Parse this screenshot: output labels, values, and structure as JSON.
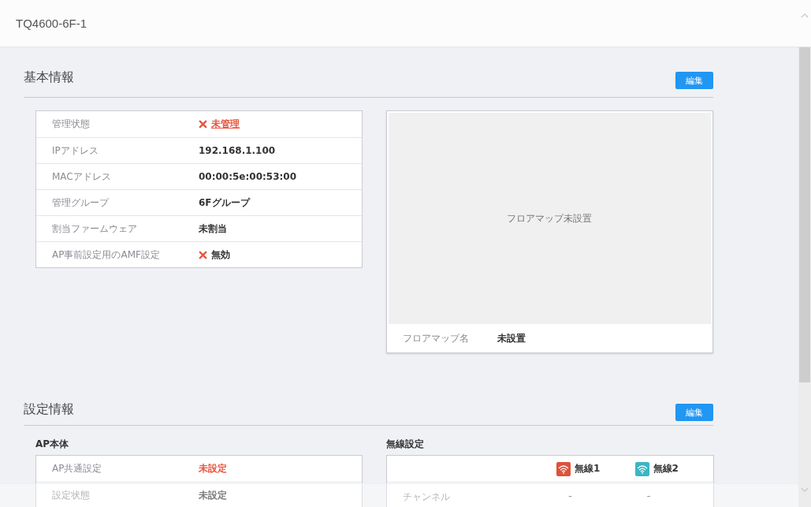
{
  "header": {
    "title": "TQ4600-6F-1"
  },
  "basic_info": {
    "title": "基本情報",
    "edit_button": "編集",
    "rows": [
      {
        "label": "管理状態",
        "value": "未管理",
        "kind": "link-alert"
      },
      {
        "label": "IPアドレス",
        "value": "192.168.1.100",
        "kind": "text"
      },
      {
        "label": "MACアドレス",
        "value": "00:00:5e:00:53:00",
        "kind": "text"
      },
      {
        "label": "管理グループ",
        "value": "6Fグループ",
        "kind": "text"
      },
      {
        "label": "割当ファームウェア",
        "value": "未割当",
        "kind": "text"
      },
      {
        "label": "AP事前設定用のAMF設定",
        "value": "無効",
        "kind": "cross"
      }
    ],
    "floor_map": {
      "empty_message": "フロアマップ未設置",
      "name_label": "フロアマップ名",
      "name_value": "未設置"
    }
  },
  "settings_info": {
    "title": "設定情報",
    "edit_button": "編集",
    "ap_body": {
      "title": "AP本体",
      "rows": [
        {
          "label": "AP共通設定",
          "value": "未設定",
          "kind": "alert"
        },
        {
          "label": "設定状態",
          "value": "未設定",
          "kind": "text"
        }
      ]
    },
    "wireless": {
      "title": "無線設定",
      "radios": [
        {
          "label": "無線1",
          "color": "#e0513a"
        },
        {
          "label": "無線2",
          "color": "#3bb6c4"
        }
      ],
      "rows": [
        {
          "label": "チャンネル",
          "values": [
            "-",
            "-"
          ]
        }
      ]
    }
  }
}
